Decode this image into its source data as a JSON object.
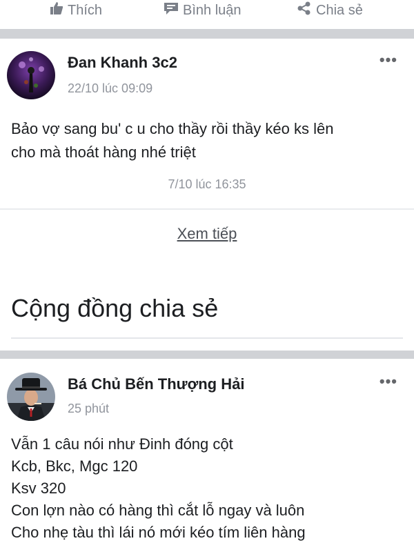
{
  "actions": {
    "like": "Thích",
    "comment": "Bình luận",
    "share": "Chia sẻ"
  },
  "post1": {
    "author": "Đan Khanh 3c2",
    "timestamp": "22/10 lúc 09:09",
    "more": "•••",
    "body": "Bảo vợ sang bu' c u cho thầy rồi thầy kéo ks lên\ncho mà thoát hàng nhé triệt",
    "reply_time": "7/10 lúc 16:35"
  },
  "see_more": "Xem tiếp",
  "section_title": "Cộng đồng chia sẻ",
  "post2": {
    "author": "Bá Chủ Bến Thượng Hải",
    "timestamp": "25 phút",
    "more": "•••",
    "body": "Vẫn 1 câu nói như Đinh đóng cột\nKcb, Bkc, Mgc 120\nKsv 320\nCon lợn nào có hàng thì cắt lỗ ngay và luôn\nCho nhẹ tàu thì lái nó mới kéo tím liên hàng"
  },
  "icons": {
    "like": "thumbs-up-icon",
    "comment": "comment-bubble-icon",
    "share": "share-icon",
    "more": "more-options-icon"
  },
  "colors": {
    "muted": "#7a7f88",
    "text": "#1c1e21",
    "separator": "#d0d2d6"
  }
}
